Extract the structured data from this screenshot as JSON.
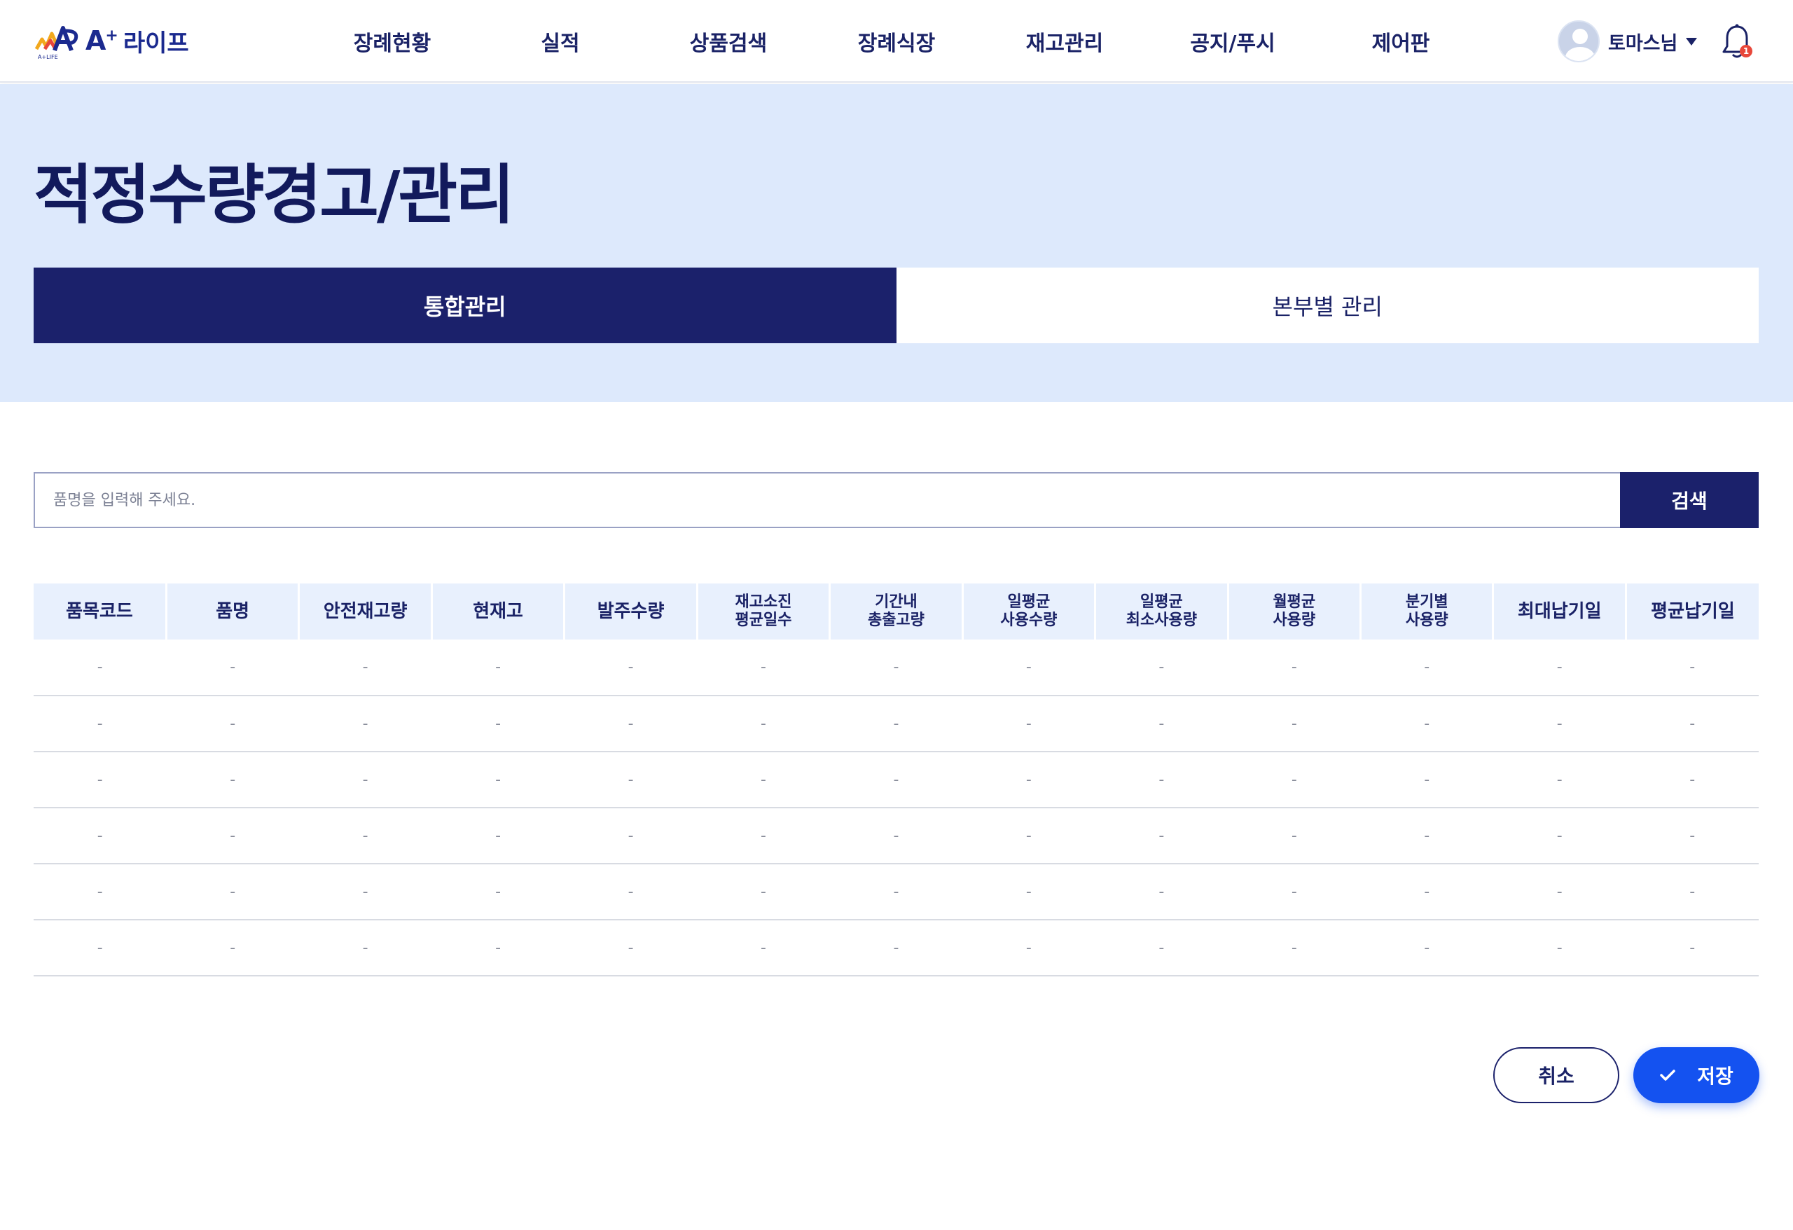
{
  "header": {
    "brand": "A",
    "brand_sup": "+",
    "brand_name": "라이프",
    "logo_sub": "A+LIFE",
    "nav": [
      "장례현황",
      "실적",
      "상품검색",
      "장례식장",
      "재고관리",
      "공지/푸시",
      "제어판"
    ],
    "user_name": "토마스님",
    "notification_count": "1"
  },
  "page": {
    "title": "적정수량경고/관리",
    "tabs": [
      {
        "label": "통합관리",
        "active": true
      },
      {
        "label": "본부별 관리",
        "active": false
      }
    ]
  },
  "search": {
    "placeholder": "품명을 입력해 주세요.",
    "value": "",
    "button_label": "검색"
  },
  "table": {
    "columns": [
      "품목코드",
      "품명",
      "안전재고량",
      "현재고",
      "발주수량",
      "재고소진\n평균일수",
      "기간내\n총출고량",
      "일평균\n사용수량",
      "일평균\n최소사용량",
      "월평균\n사용량",
      "분기별\n사용량",
      "최대납기일",
      "평균납기일"
    ],
    "empty_cell": "-",
    "rows": [
      [
        "-",
        "-",
        "-",
        "-",
        "-",
        "-",
        "-",
        "-",
        "-",
        "-",
        "-",
        "-",
        "-"
      ],
      [
        "-",
        "-",
        "-",
        "-",
        "-",
        "-",
        "-",
        "-",
        "-",
        "-",
        "-",
        "-",
        "-"
      ],
      [
        "-",
        "-",
        "-",
        "-",
        "-",
        "-",
        "-",
        "-",
        "-",
        "-",
        "-",
        "-",
        "-"
      ],
      [
        "-",
        "-",
        "-",
        "-",
        "-",
        "-",
        "-",
        "-",
        "-",
        "-",
        "-",
        "-",
        "-"
      ],
      [
        "-",
        "-",
        "-",
        "-",
        "-",
        "-",
        "-",
        "-",
        "-",
        "-",
        "-",
        "-",
        "-"
      ],
      [
        "-",
        "-",
        "-",
        "-",
        "-",
        "-",
        "-",
        "-",
        "-",
        "-",
        "-",
        "-",
        "-"
      ]
    ]
  },
  "actions": {
    "cancel_label": "취소",
    "save_label": "저장"
  },
  "colors": {
    "navy": "#1b216b",
    "hero_bg": "#dde9fc",
    "save_blue": "#1452f0",
    "badge_red": "#e8473a"
  }
}
